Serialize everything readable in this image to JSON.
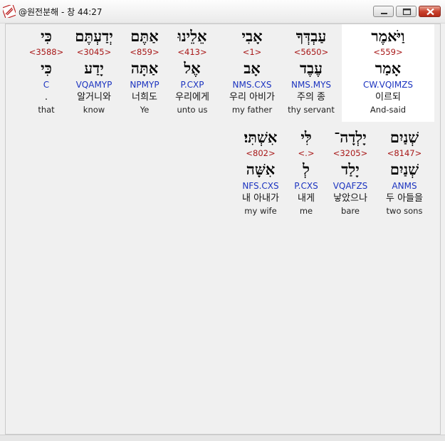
{
  "window": {
    "title": "@원전분해 - 창 44:27",
    "controls": [
      "minimize-icon",
      "maximize-icon",
      "close-icon"
    ]
  },
  "colors": {
    "strong_number": "#a81818",
    "parsing": "#1c34c0",
    "highlight_background": "#ffffff"
  },
  "words": [
    {
      "hebrew": "וַיֹּאמֶר",
      "strong": "<559>",
      "lemma": "אָמַר",
      "parsing": "CW.VQIMZS",
      "korean": "이르되",
      "english": "And-said",
      "selected": true
    },
    {
      "hebrew": "עַבְדְּךָ",
      "strong": "<5650>",
      "lemma": "עֶבֶד",
      "parsing": "NMS.MYS",
      "korean": "주의 종",
      "english": "thy servant"
    },
    {
      "hebrew": "אָבִי",
      "strong": "<1>",
      "lemma": "אָב",
      "parsing": "NMS.CXS",
      "korean": "우리 아비가",
      "english": "my father"
    },
    {
      "hebrew": "אֵלֵינוּ",
      "strong": "<413>",
      "lemma": "אֶל",
      "parsing": "P.CXP",
      "korean": "우리에게",
      "english": "unto us"
    },
    {
      "hebrew": "אַתֶּם",
      "strong": "<859>",
      "lemma": "אַתָּה",
      "parsing": "NPMYP",
      "korean": "너희도",
      "english": "Ye"
    },
    {
      "hebrew": "יְדַעְתֶּם",
      "strong": "<3045>",
      "lemma": "יָדַע",
      "parsing": "VQAMYP",
      "korean": "알거니와",
      "english": "know"
    },
    {
      "hebrew": "כִּי",
      "strong": "<3588>",
      "lemma": "כִּי",
      "parsing": "C",
      "korean": ".",
      "english": "that"
    },
    {
      "hebrew": "שְׁנַיִם",
      "strong": "<8147>",
      "lemma": "שְׁנַיִם",
      "parsing": "ANMS",
      "korean": "두 아들을",
      "english": "two sons"
    },
    {
      "hebrew": "יָלְדָה־",
      "strong": "<3205>",
      "lemma": "יָלַד",
      "parsing": "VQAFZS",
      "korean": "낳았으나",
      "english": "bare"
    },
    {
      "hebrew": "לִּי",
      "strong": "<.>",
      "lemma": "לְ",
      "parsing": "P.CXS",
      "korean": "내게",
      "english": "me"
    },
    {
      "hebrew": "אִשְׁתִּי׃",
      "strong": "<802>",
      "lemma": "אִשָּׁה",
      "parsing": "NFS.CXS",
      "korean": "내 아내가",
      "english": "my wife"
    }
  ]
}
